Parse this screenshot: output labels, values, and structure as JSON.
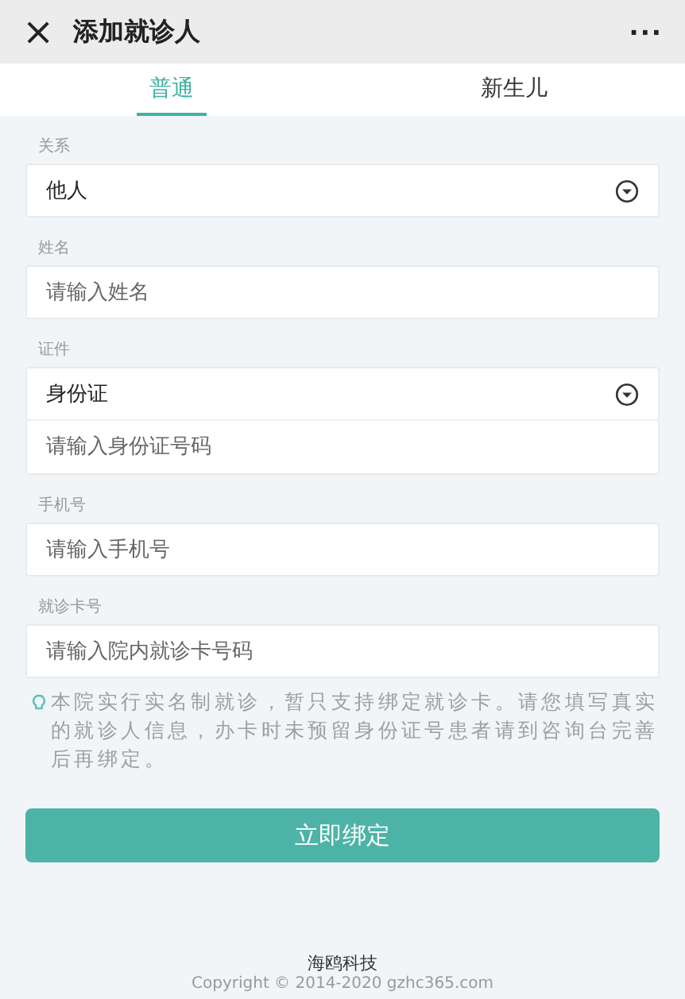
{
  "header": {
    "close": "×",
    "title": "添加就诊人",
    "more": "···"
  },
  "tabs": [
    {
      "label": "普通",
      "selected": true
    },
    {
      "label": "新生儿",
      "selected": false
    }
  ],
  "groups": [
    {
      "label": "关系",
      "rows": [
        {
          "kind": "select",
          "value": "他人"
        }
      ]
    },
    {
      "label": "姓名",
      "rows": [
        {
          "kind": "input",
          "placeholder": "请输入姓名"
        }
      ]
    },
    {
      "label": "证件",
      "rows": [
        {
          "kind": "select",
          "value": "身份证"
        },
        {
          "kind": "input",
          "placeholder": "请输入身份证号码"
        }
      ]
    },
    {
      "label": "手机号",
      "rows": [
        {
          "kind": "input",
          "placeholder": "请输入手机号"
        }
      ]
    },
    {
      "label": "就诊卡号",
      "rows": [
        {
          "kind": "input",
          "placeholder": "请输入院内就诊卡号码"
        }
      ]
    }
  ],
  "notice": "本院实行实名制就诊，暂只支持绑定就诊卡。请您填写真实的就诊人信息，办卡时未预留身份证号患者请到咨询台完善后再绑定。",
  "button": "立即绑定",
  "footer": {
    "company": "海鸥科技",
    "copyright": "Copyright © 2014-2020 gzhc365.com"
  }
}
